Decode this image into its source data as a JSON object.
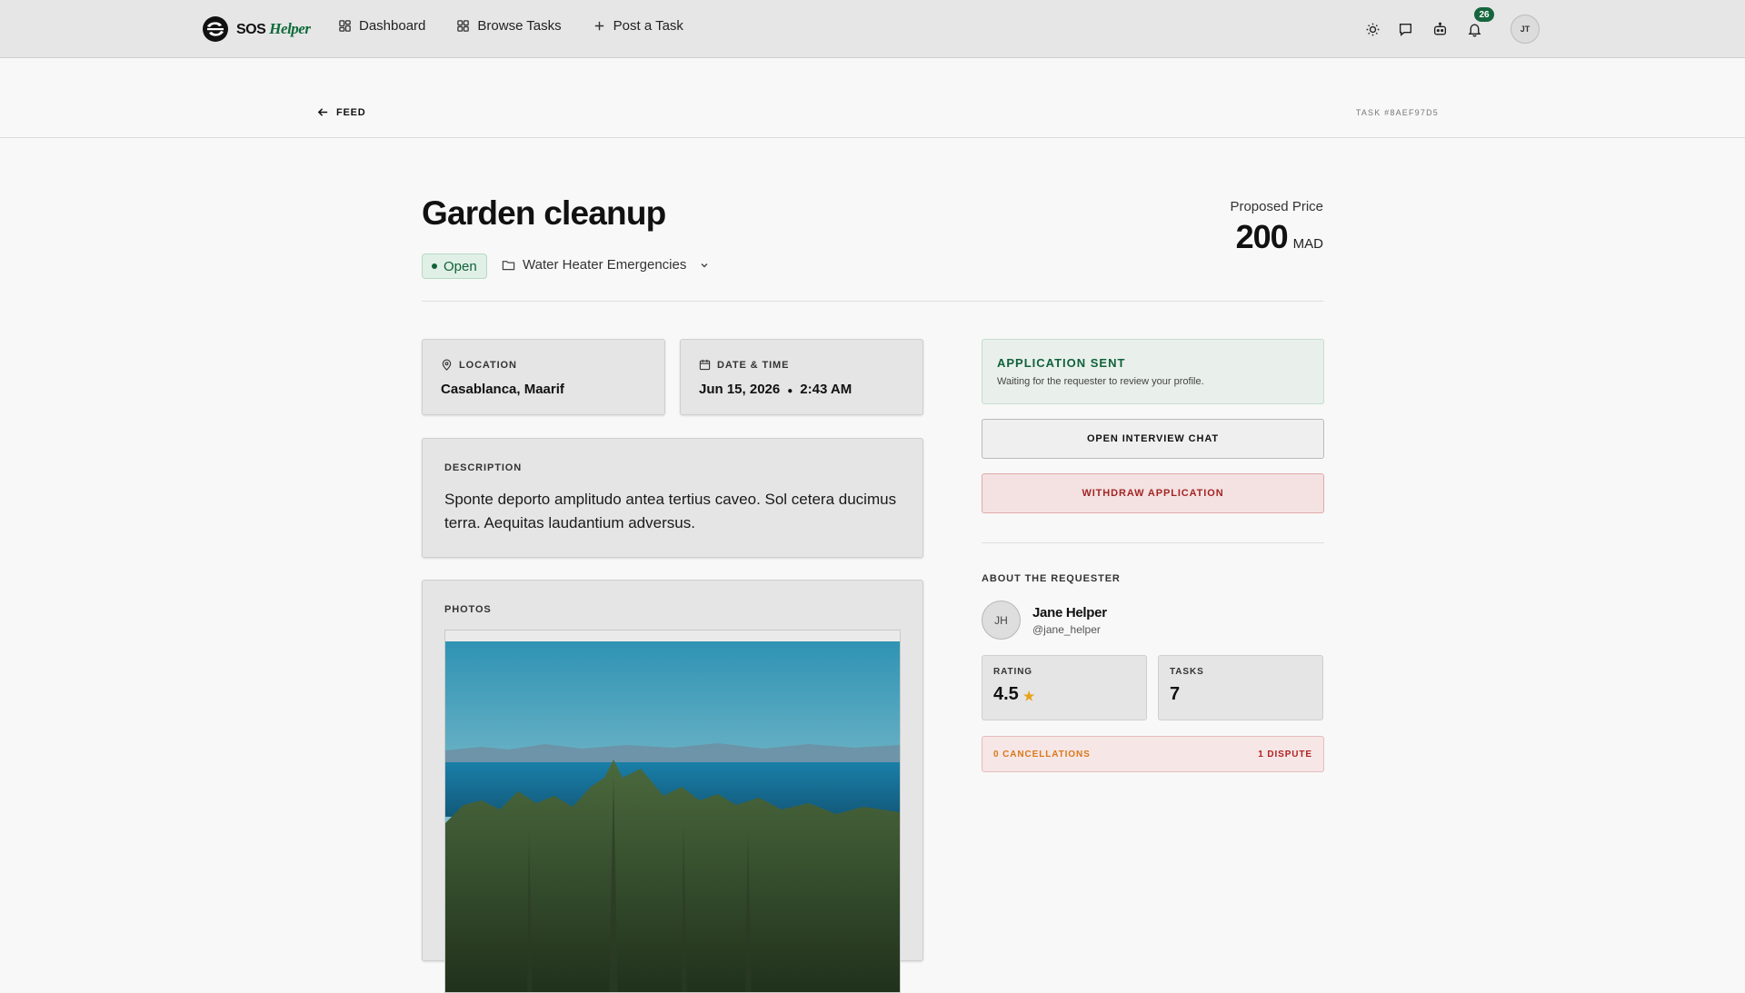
{
  "nav": {
    "brand_sos": "SOS",
    "brand_helper": "Helper",
    "links": [
      {
        "label": "Dashboard",
        "icon": "dashboard-icon"
      },
      {
        "label": "Browse Tasks",
        "icon": "grid-icon"
      },
      {
        "label": "Post a Task",
        "icon": "plus-icon"
      }
    ],
    "notification_count": "26",
    "user_initials": "JT"
  },
  "subheader": {
    "back_label": "FEED",
    "task_id": "TASK #8AEF97D5"
  },
  "task": {
    "title": "Garden cleanup",
    "status": "Open",
    "category": "Water Heater Emergencies",
    "price_label": "Proposed Price",
    "price_value": "200",
    "price_currency": "MAD",
    "location_label": "LOCATION",
    "location_value": "Casablanca, Maarif",
    "datetime_label": "DATE & TIME",
    "date_value": "Jun 15, 2026",
    "time_value": "2:43 AM",
    "description_label": "DESCRIPTION",
    "description": "Sponte deporto amplitudo antea tertius caveo. Sol cetera ducimus terra. Aequitas laudantium adversus.",
    "photos_label": "PHOTOS"
  },
  "application": {
    "status_title": "APPLICATION SENT",
    "status_text": "Waiting for the requester to review your profile.",
    "chat_button": "OPEN INTERVIEW CHAT",
    "withdraw_button": "WITHDRAW APPLICATION"
  },
  "requester": {
    "section_title": "ABOUT THE REQUESTER",
    "initials": "JH",
    "name": "Jane Helper",
    "handle": "@jane_helper",
    "rating_label": "RATING",
    "rating_value": "4.5",
    "tasks_label": "TASKS",
    "tasks_value": "7",
    "cancellations": "0 CANCELLATIONS",
    "disputes": "1 DISPUTE"
  },
  "colors": {
    "accent_green": "#11613a",
    "danger_red": "#a32626",
    "warning_orange": "#d9781a",
    "star": "#e8a21a"
  }
}
